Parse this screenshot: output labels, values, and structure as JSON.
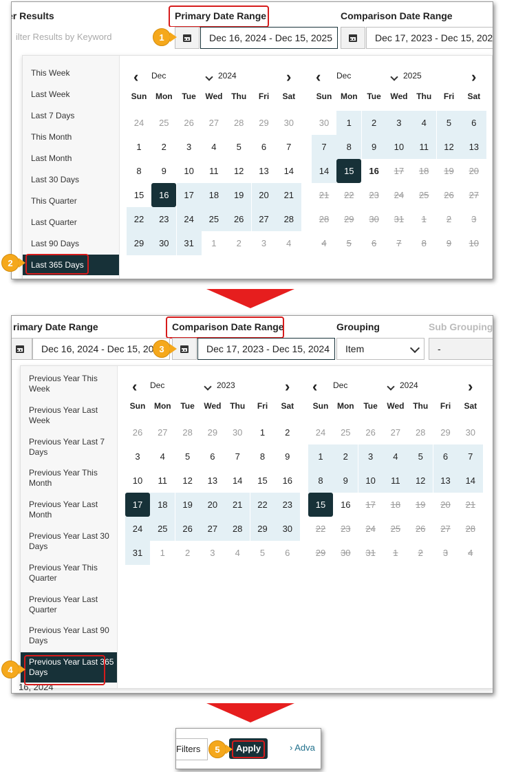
{
  "step1": {
    "filter_results_header": "er Results",
    "primary_header": "Primary Date Range",
    "comparison_header": "Comparison Date Range",
    "keyword_placeholder": "ilter Results by Keyword",
    "primary_value": "Dec 16, 2024 - Dec 15, 2025",
    "comparison_value": "Dec 17, 2023 - Dec 15, 2024",
    "presets": [
      "This Week",
      "Last Week",
      "Last 7 Days",
      "This Month",
      "Last Month",
      "Last 30 Days",
      "This Quarter",
      "Last Quarter",
      "Last 90 Days",
      "Last 365 Days"
    ],
    "selected_preset": "Last 365 Days",
    "left_month": "Dec",
    "left_year": "2024",
    "right_month": "Dec",
    "right_year": "2025",
    "badge1": "1",
    "badge2": "2"
  },
  "step2": {
    "primary_header": "rimary Date Range",
    "comparison_header": "Comparison Date Range",
    "grouping_header": "Grouping",
    "subgrouping_header": "Sub Grouping",
    "primary_value": "Dec 16, 2024 - Dec 15, 202",
    "comparison_value": "Dec 17, 2023 - Dec 15, 2024",
    "grouping_value": "Item",
    "subgrouping_value": "-",
    "presets": [
      "Previous Year This Week",
      "Previous Year Last Week",
      "Previous Year Last 7 Days",
      "Previous Year This Month",
      "Previous Year Last Month",
      "Previous Year Last 30 Days",
      "Previous Year This Quarter",
      "Previous Year Last Quarter",
      "Previous Year Last 90 Days",
      "Previous Year Last 365 Days"
    ],
    "selected_preset": "Previous Year Last 365 Days",
    "left_month": "Dec",
    "left_year": "2023",
    "right_month": "Dec",
    "right_year": "2024",
    "behind_text": "16, 2024",
    "badge3": "3",
    "badge4": "4"
  },
  "step3": {
    "filters_label": "Filters",
    "apply_label": "Apply",
    "advanced_label": "› Adva",
    "badge5": "5"
  },
  "weekdays": [
    "Sun",
    "Mon",
    "Tue",
    "Wed",
    "Thu",
    "Fri",
    "Sat"
  ],
  "calendars": {
    "c1_left": [
      [
        [
          "24",
          "out"
        ],
        [
          "25",
          "out"
        ],
        [
          "26",
          "out"
        ],
        [
          "27",
          "out"
        ],
        [
          "28",
          "out"
        ],
        [
          "29",
          "out"
        ],
        [
          "30",
          "out"
        ]
      ],
      [
        [
          "1",
          ""
        ],
        [
          "2",
          ""
        ],
        [
          "3",
          ""
        ],
        [
          "4",
          ""
        ],
        [
          "5",
          ""
        ],
        [
          "6",
          ""
        ],
        [
          "7",
          ""
        ]
      ],
      [
        [
          "8",
          ""
        ],
        [
          "9",
          ""
        ],
        [
          "10",
          ""
        ],
        [
          "11",
          ""
        ],
        [
          "12",
          ""
        ],
        [
          "13",
          ""
        ],
        [
          "14",
          ""
        ]
      ],
      [
        [
          "15",
          ""
        ],
        [
          "16",
          "sel"
        ],
        [
          "17",
          "range"
        ],
        [
          "18",
          "range"
        ],
        [
          "19",
          "range"
        ],
        [
          "20",
          "range"
        ],
        [
          "21",
          "range"
        ]
      ],
      [
        [
          "22",
          "range"
        ],
        [
          "23",
          "range"
        ],
        [
          "24",
          "range"
        ],
        [
          "25",
          "range"
        ],
        [
          "26",
          "range"
        ],
        [
          "27",
          "range"
        ],
        [
          "28",
          "range"
        ]
      ],
      [
        [
          "29",
          "range"
        ],
        [
          "30",
          "range"
        ],
        [
          "31",
          "range"
        ],
        [
          "1",
          "out"
        ],
        [
          "2",
          "out"
        ],
        [
          "3",
          "out"
        ],
        [
          "4",
          "out"
        ]
      ]
    ],
    "c1_right": [
      [
        [
          "30",
          "out"
        ],
        [
          "1",
          "range"
        ],
        [
          "2",
          "range"
        ],
        [
          "3",
          "range"
        ],
        [
          "4",
          "range"
        ],
        [
          "5",
          "range"
        ],
        [
          "6",
          "range"
        ]
      ],
      [
        [
          "7",
          "range"
        ],
        [
          "8",
          "range"
        ],
        [
          "9",
          "range"
        ],
        [
          "10",
          "range"
        ],
        [
          "11",
          "range"
        ],
        [
          "12",
          "range"
        ],
        [
          "13",
          "range"
        ]
      ],
      [
        [
          "14",
          "range"
        ],
        [
          "15",
          "sel"
        ],
        [
          "16",
          "today"
        ],
        [
          "17",
          "dis"
        ],
        [
          "18",
          "dis"
        ],
        [
          "19",
          "dis"
        ],
        [
          "20",
          "dis"
        ]
      ],
      [
        [
          "21",
          "dis"
        ],
        [
          "22",
          "dis"
        ],
        [
          "23",
          "dis"
        ],
        [
          "24",
          "dis"
        ],
        [
          "25",
          "dis"
        ],
        [
          "26",
          "dis"
        ],
        [
          "27",
          "dis"
        ]
      ],
      [
        [
          "28",
          "dis"
        ],
        [
          "29",
          "dis"
        ],
        [
          "30",
          "dis"
        ],
        [
          "31",
          "dis"
        ],
        [
          "1",
          "dis"
        ],
        [
          "2",
          "dis"
        ],
        [
          "3",
          "dis"
        ]
      ],
      [
        [
          "4",
          "dis"
        ],
        [
          "5",
          "dis"
        ],
        [
          "6",
          "dis"
        ],
        [
          "7",
          "dis"
        ],
        [
          "8",
          "dis"
        ],
        [
          "9",
          "dis"
        ],
        [
          "10",
          "dis"
        ]
      ]
    ],
    "c2_left": [
      [
        [
          "26",
          "out"
        ],
        [
          "27",
          "out"
        ],
        [
          "28",
          "out"
        ],
        [
          "29",
          "out"
        ],
        [
          "30",
          "out"
        ],
        [
          "1",
          ""
        ],
        [
          "2",
          ""
        ]
      ],
      [
        [
          "3",
          ""
        ],
        [
          "4",
          ""
        ],
        [
          "5",
          ""
        ],
        [
          "6",
          ""
        ],
        [
          "7",
          ""
        ],
        [
          "8",
          ""
        ],
        [
          "9",
          ""
        ]
      ],
      [
        [
          "10",
          ""
        ],
        [
          "11",
          ""
        ],
        [
          "12",
          ""
        ],
        [
          "13",
          ""
        ],
        [
          "14",
          ""
        ],
        [
          "15",
          ""
        ],
        [
          "16",
          ""
        ]
      ],
      [
        [
          "17",
          "sel"
        ],
        [
          "18",
          "range"
        ],
        [
          "19",
          "range"
        ],
        [
          "20",
          "range"
        ],
        [
          "21",
          "range"
        ],
        [
          "22",
          "range"
        ],
        [
          "23",
          "range"
        ]
      ],
      [
        [
          "24",
          "range"
        ],
        [
          "25",
          "range"
        ],
        [
          "26",
          "range"
        ],
        [
          "27",
          "range"
        ],
        [
          "28",
          "range"
        ],
        [
          "29",
          "range"
        ],
        [
          "30",
          "range"
        ]
      ],
      [
        [
          "31",
          "range"
        ],
        [
          "1",
          "out"
        ],
        [
          "2",
          "out"
        ],
        [
          "3",
          "out"
        ],
        [
          "4",
          "out"
        ],
        [
          "5",
          "out"
        ],
        [
          "6",
          "out"
        ]
      ]
    ],
    "c2_right": [
      [
        [
          "24",
          "out"
        ],
        [
          "25",
          "out"
        ],
        [
          "26",
          "out"
        ],
        [
          "27",
          "out"
        ],
        [
          "28",
          "out"
        ],
        [
          "29",
          "out"
        ],
        [
          "30",
          "out"
        ]
      ],
      [
        [
          "1",
          "range"
        ],
        [
          "2",
          "range"
        ],
        [
          "3",
          "range"
        ],
        [
          "4",
          "range"
        ],
        [
          "5",
          "range"
        ],
        [
          "6",
          "range"
        ],
        [
          "7",
          "range"
        ]
      ],
      [
        [
          "8",
          "range"
        ],
        [
          "9",
          "range"
        ],
        [
          "10",
          "range"
        ],
        [
          "11",
          "range"
        ],
        [
          "12",
          "range"
        ],
        [
          "13",
          "range"
        ],
        [
          "14",
          "range"
        ]
      ],
      [
        [
          "15",
          "sel"
        ],
        [
          "16",
          ""
        ],
        [
          "17",
          "dis"
        ],
        [
          "18",
          "dis"
        ],
        [
          "19",
          "dis"
        ],
        [
          "20",
          "dis"
        ],
        [
          "21",
          "dis"
        ]
      ],
      [
        [
          "22",
          "dis"
        ],
        [
          "23",
          "dis"
        ],
        [
          "24",
          "dis"
        ],
        [
          "25",
          "dis"
        ],
        [
          "26",
          "dis"
        ],
        [
          "27",
          "dis"
        ],
        [
          "28",
          "dis"
        ]
      ],
      [
        [
          "29",
          "dis"
        ],
        [
          "30",
          "dis"
        ],
        [
          "31",
          "dis"
        ],
        [
          "1",
          "dis"
        ],
        [
          "2",
          "dis"
        ],
        [
          "3",
          "dis"
        ],
        [
          "4",
          "dis"
        ]
      ]
    ]
  },
  "colors": {
    "selected": "#173138",
    "range": "#e4f0f5",
    "callout": "#d61b1b",
    "badge": "#f5a81c",
    "step_arrow": "#e61e1e"
  }
}
